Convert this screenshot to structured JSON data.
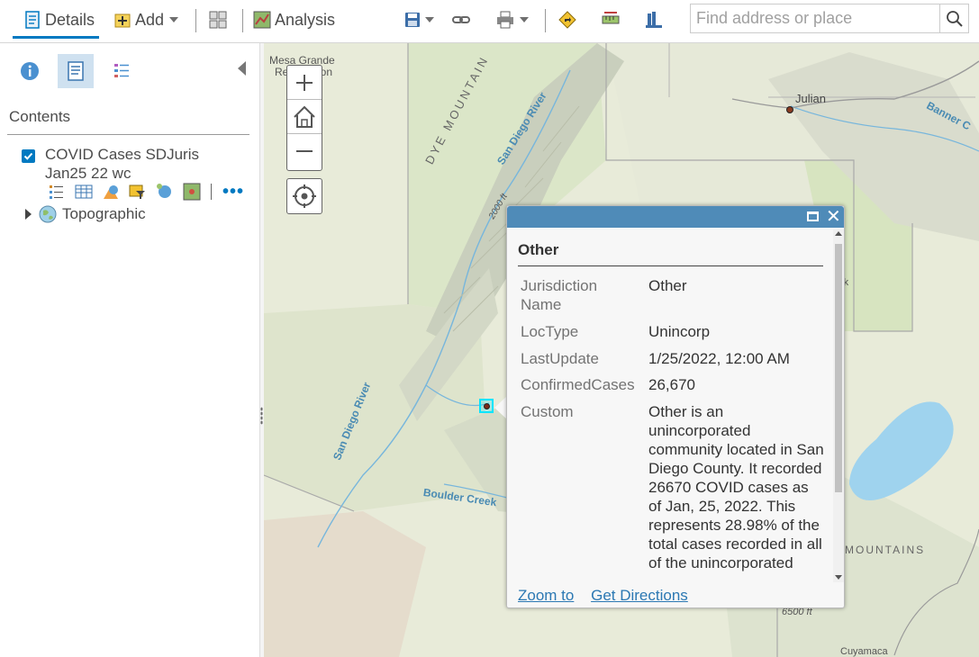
{
  "toolbar": {
    "details_label": "Details",
    "add_label": "Add",
    "analysis_label": "Analysis",
    "search_placeholder": "Find address or place"
  },
  "panel": {
    "contents_title": "Contents",
    "layer_name": "COVID Cases SDJuris Jan25 22 wc",
    "layer_checked": true,
    "basemap_name": "Topographic"
  },
  "map": {
    "labels": {
      "mesa_grande": "Mesa Grande",
      "mesa_grande_2": "Reservation",
      "julian": "Julian",
      "dye_mountain": "DYE MOUNTAIN",
      "san_diego_river_top": "San Diego River",
      "san_diego_river_bottom": "San Diego River",
      "boulder_creek": "Boulder Creek",
      "banner": "Banner C",
      "mountains": "MOUNTAINS",
      "cuyamaca": "Cuyamaca",
      "contour_2000": "2000 ft",
      "contour_6500": "6500 ft",
      "park": "rk"
    }
  },
  "popup": {
    "title": "Other",
    "attributes": [
      {
        "label": "Jurisdiction Name",
        "value": "Other"
      },
      {
        "label": "LocType",
        "value": "Unincorp"
      },
      {
        "label": "LastUpdate",
        "value": "1/25/2022, 12:00 AM"
      },
      {
        "label": "ConfirmedCases",
        "value": "26,670"
      },
      {
        "label": "Custom",
        "value": "Other is an unincorporated community located in San Diego County. It recorded 26670 COVID cases as of Jan, 25, 2022. This represents 28.98% of the total cases recorded in all of the unincorporated"
      }
    ],
    "zoom_to": "Zoom to",
    "get_directions": "Get Directions"
  },
  "colors": {
    "accent": "#0079c1",
    "popup_header": "#4f8bb8",
    "link": "#2b78b3",
    "selection": "#00e5ff"
  }
}
